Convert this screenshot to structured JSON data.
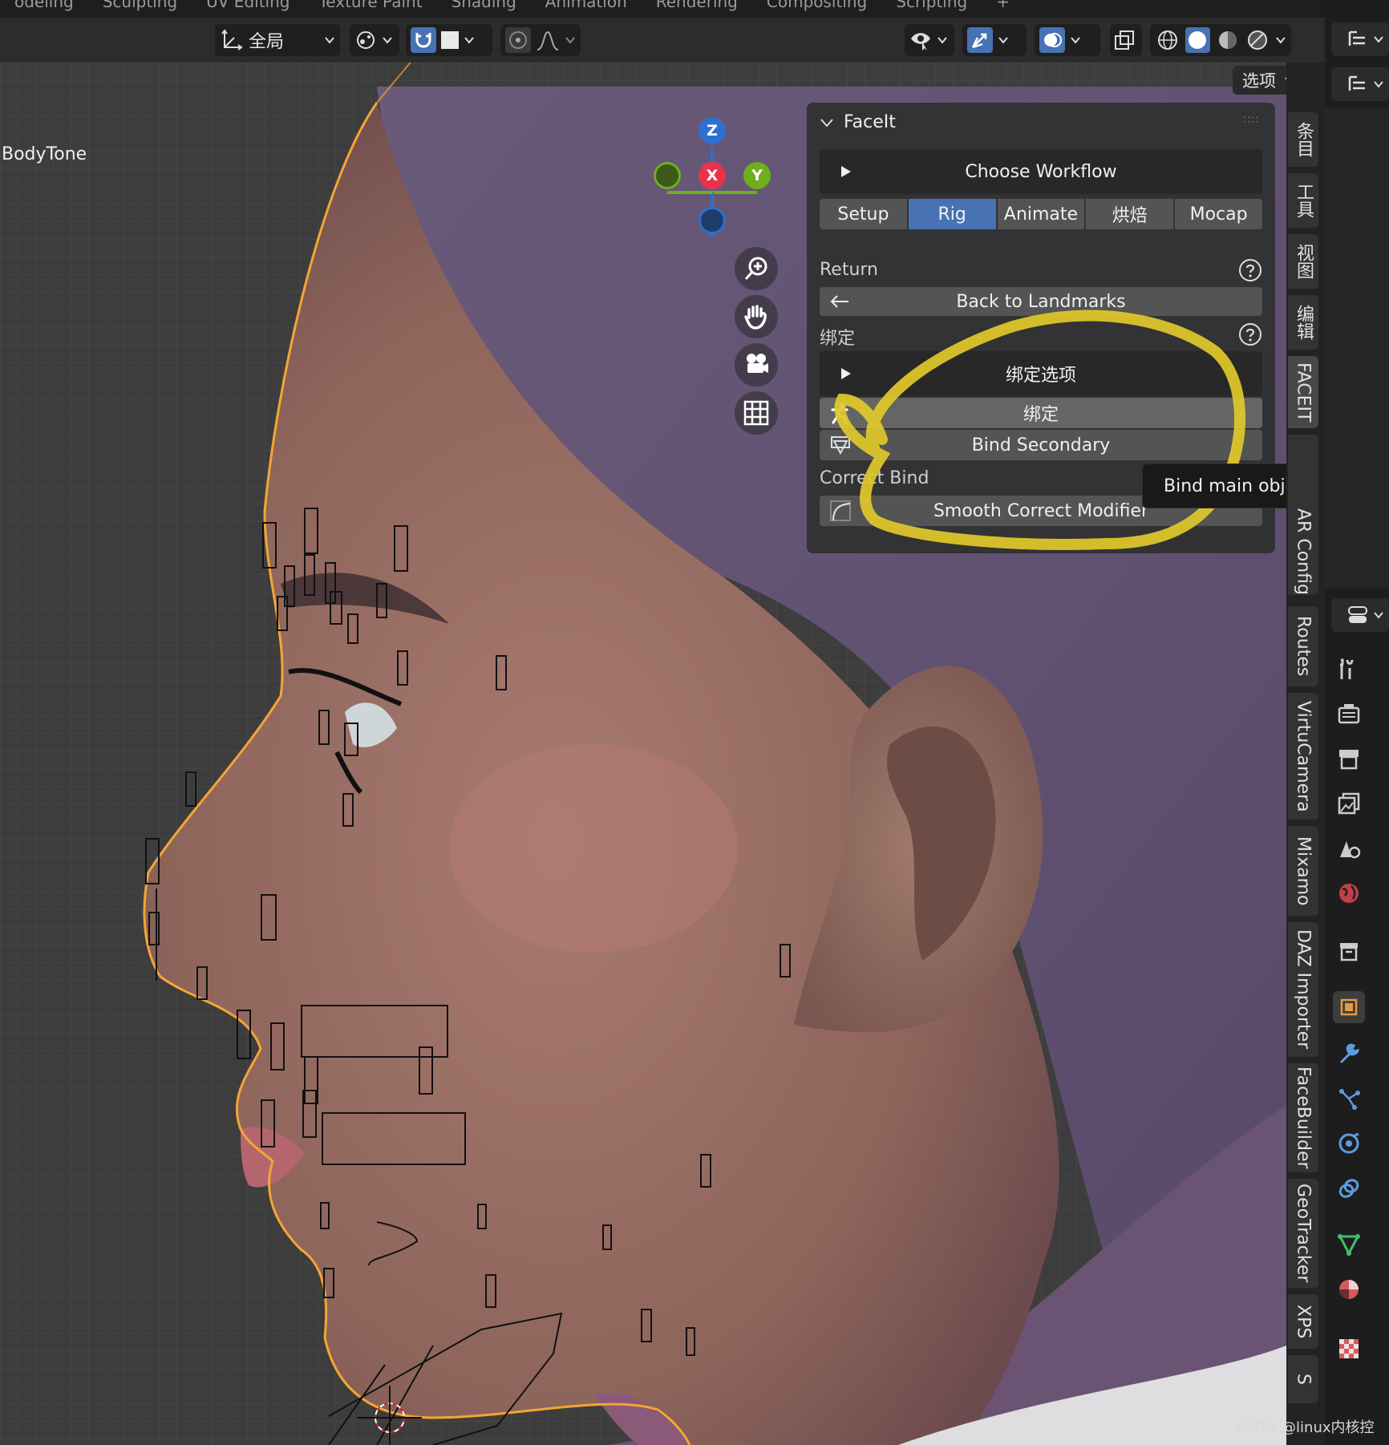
{
  "workspace_tabs": [
    "odeling",
    "Sculpting",
    "UV Editing",
    "Texture Paint",
    "Shading",
    "Animation",
    "Rendering",
    "Compositing",
    "Scripting",
    "+"
  ],
  "header": {
    "transform_orientation": "全局",
    "options_label": "选项"
  },
  "viewport": {
    "object_name": "BodyTone",
    "gizmo": {
      "x": "X",
      "y": "Y",
      "z": "Z"
    },
    "nav_buttons": [
      "zoom-icon",
      "hand-pan-icon",
      "camera-icon",
      "grid-icon"
    ]
  },
  "faceit": {
    "title": "FaceIt",
    "choose_workflow": "Choose Workflow",
    "tabs": [
      {
        "label": "Setup",
        "active": false
      },
      {
        "label": "Rig",
        "active": true
      },
      {
        "label": "Animate",
        "active": false
      },
      {
        "label": "烘焙",
        "active": false
      },
      {
        "label": "Mocap",
        "active": false
      }
    ],
    "return_label": "Return",
    "back_to_landmarks": "Back to Landmarks",
    "bind_label": "绑定",
    "bind_options": "绑定选项",
    "bind_button": "绑定",
    "bind_secondary": "Bind Secondary",
    "correct_bind_label": "Correct Bind",
    "smooth_correct_modifier": "Smooth Correct Modifier"
  },
  "tooltip": "Bind main objects (Face, E",
  "sidebar_tabs": [
    "条目",
    "工具",
    "视图",
    "编辑",
    "FACEIT",
    "AR Config",
    "Routes",
    "VirtuCamera",
    "Mixamo",
    "DAZ Importer",
    "FaceBuilder",
    "GeoTracker",
    "XPS",
    "S"
  ],
  "active_sidebar_tab": "FACEIT",
  "properties_icons": [
    "tool-icon",
    "render-icon",
    "output-icon",
    "view-layer-icon",
    "scene-icon",
    "world-icon",
    "collection-icon",
    "object-icon",
    "modifier-icon",
    "particles-icon",
    "physics-icon",
    "constraints-icon",
    "data-icon",
    "material-icon",
    "texture-icon"
  ],
  "colors": {
    "accent": "#4772b3",
    "axis_x": "#e8334b",
    "axis_y": "#6fae1c",
    "axis_z": "#2f6fd0",
    "selection_outline": "#f5a534",
    "annotation": "#e2c92a"
  },
  "watermark": "CSDN @linux内核控"
}
